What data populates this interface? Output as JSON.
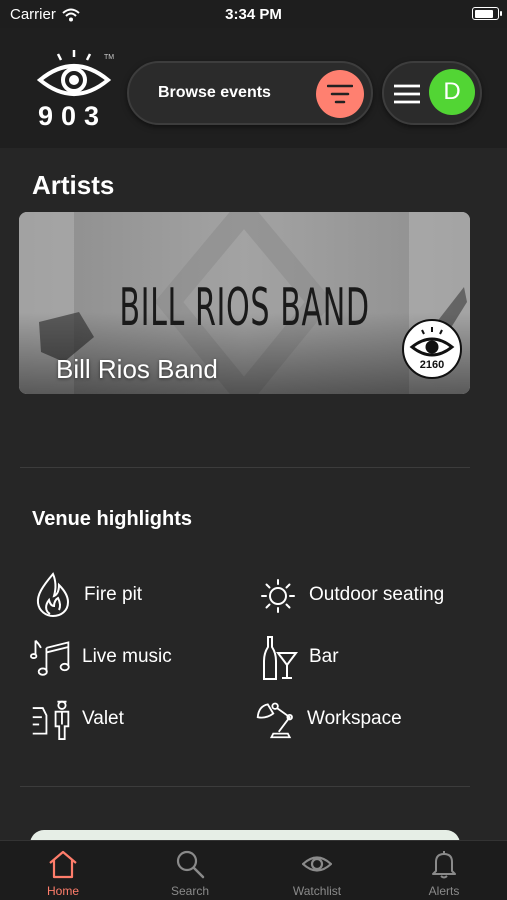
{
  "status_bar": {
    "carrier": "Carrier",
    "time": "3:34 PM",
    "battery_level": 0.85
  },
  "header": {
    "logo_number": "903",
    "logo_tm": "TM",
    "browse_label": "Browse events",
    "filter_icon": "filter-icon",
    "menu_icon": "hamburger-icon",
    "avatar_initial": "D",
    "accent_color": "#ff8070",
    "avatar_color": "#52d534"
  },
  "artists": {
    "title": "Artists",
    "items": [
      {
        "band_logo_text": "BILL RIOS BAND",
        "name": "Bill Rios Band",
        "badge_number": "2160"
      }
    ]
  },
  "venue": {
    "title": "Venue highlights",
    "amenities": [
      {
        "label": "Fire pit",
        "icon": "fire-icon"
      },
      {
        "label": "Outdoor seating",
        "icon": "sun-icon"
      },
      {
        "label": "Live music",
        "icon": "music-note-icon"
      },
      {
        "label": "Bar",
        "icon": "cocktail-icon"
      },
      {
        "label": "Valet",
        "icon": "valet-icon"
      },
      {
        "label": "Workspace",
        "icon": "desk-lamp-icon"
      }
    ]
  },
  "tabbar": {
    "tabs": [
      {
        "label": "Home",
        "icon": "home-icon",
        "active": true
      },
      {
        "label": "Search",
        "icon": "search-icon",
        "active": false
      },
      {
        "label": "Watchlist",
        "icon": "eye-icon",
        "active": false
      },
      {
        "label": "Alerts",
        "icon": "bell-icon",
        "active": false
      }
    ],
    "active_color": "#ff7d6b"
  }
}
